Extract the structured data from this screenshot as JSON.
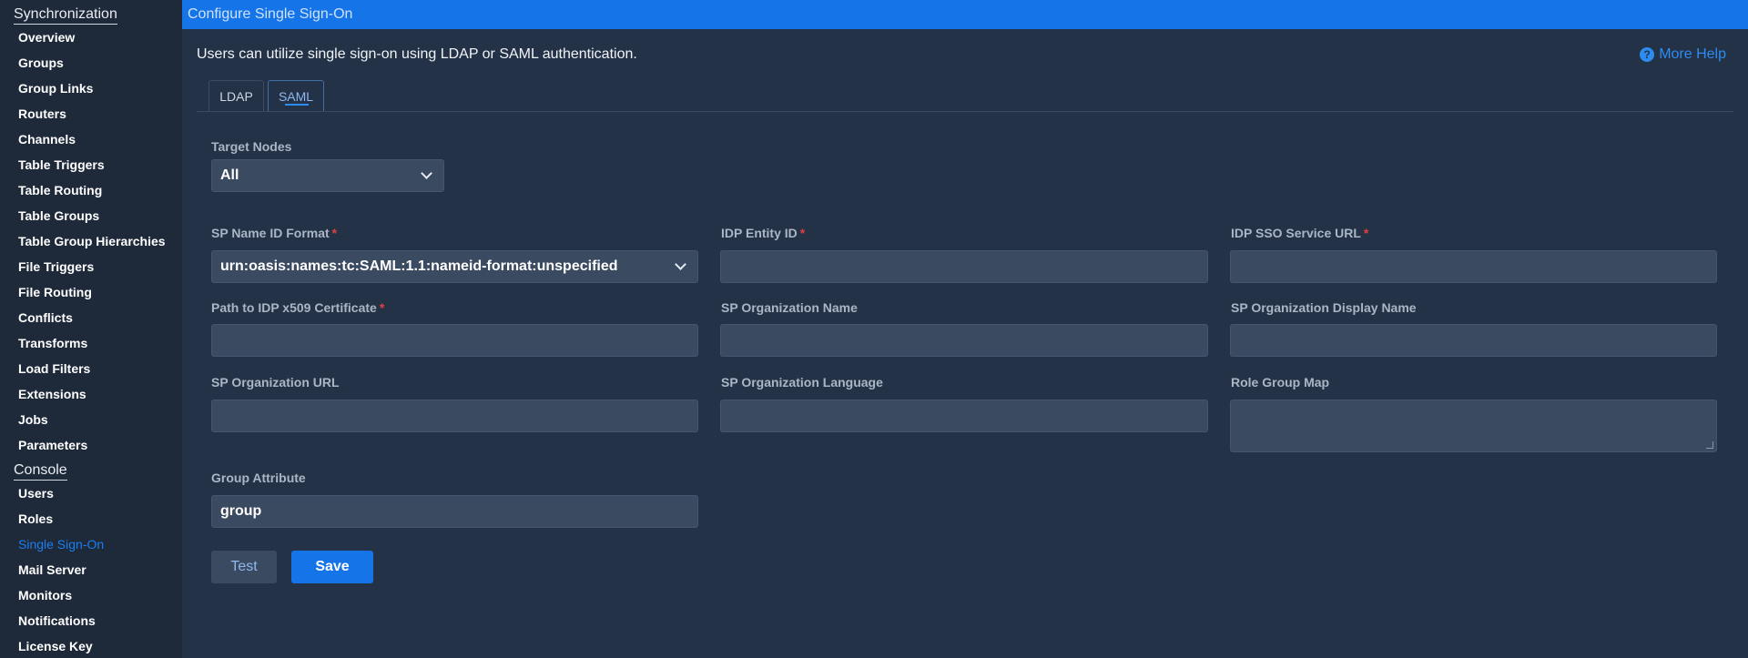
{
  "sidebar": {
    "sync_title": "Synchronization",
    "sync_items": [
      "Overview",
      "Groups",
      "Group Links",
      "Routers",
      "Channels",
      "Table Triggers",
      "Table Routing",
      "Table Groups",
      "Table Group Hierarchies",
      "File Triggers",
      "File Routing",
      "Conflicts",
      "Transforms",
      "Load Filters",
      "Extensions",
      "Jobs",
      "Parameters"
    ],
    "console_title": "Console",
    "console_items": [
      "Users",
      "Roles",
      "Single Sign-On",
      "Mail Server",
      "Monitors",
      "Notifications",
      "License Key"
    ],
    "active_item": "Single Sign-On"
  },
  "header": {
    "title": "Configure Single Sign-On"
  },
  "main": {
    "intro": "Users can utilize single sign-on using LDAP or SAML authentication.",
    "more_help": "More Help",
    "help_icon": "question-circle-icon",
    "tabs": [
      {
        "label": "LDAP",
        "active": false
      },
      {
        "label": "SAML",
        "active": true
      }
    ]
  },
  "form": {
    "target_nodes": {
      "label": "Target Nodes",
      "value": "All"
    },
    "sp_name_id_format": {
      "label": "SP Name ID Format",
      "required": "*",
      "value": "urn:oasis:names:tc:SAML:1.1:nameid-format:unspecified"
    },
    "idp_entity_id": {
      "label": "IDP Entity ID",
      "required": "*",
      "value": ""
    },
    "idp_sso_service_url": {
      "label": "IDP SSO Service URL",
      "required": "*",
      "value": ""
    },
    "idp_cert_path": {
      "label": "Path to IDP x509 Certificate",
      "required": "*",
      "value": ""
    },
    "sp_org_name": {
      "label": "SP Organization Name",
      "value": ""
    },
    "sp_org_display_name": {
      "label": "SP Organization Display Name",
      "value": ""
    },
    "sp_org_url": {
      "label": "SP Organization URL",
      "value": ""
    },
    "sp_org_language": {
      "label": "SP Organization Language",
      "value": ""
    },
    "role_group_map": {
      "label": "Role Group Map",
      "value": ""
    },
    "group_attribute": {
      "label": "Group Attribute",
      "value": "group"
    }
  },
  "buttons": {
    "test": "Test",
    "save": "Save"
  },
  "colors": {
    "header": "#1474e8",
    "accent": "#1a7ff0",
    "background": "#243247",
    "sidebar": "#1e2939",
    "required": "#e0403a"
  }
}
